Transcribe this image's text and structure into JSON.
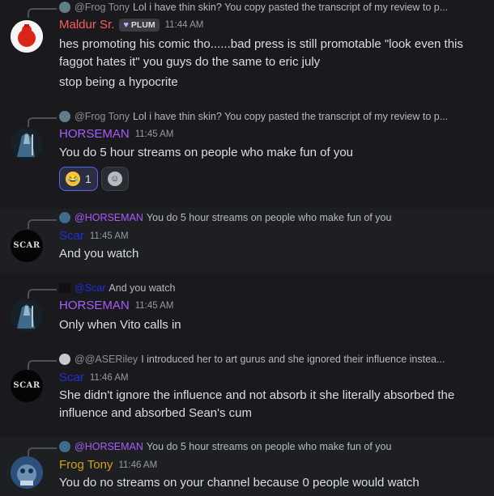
{
  "colors": {
    "maldur": "#ff5c5c",
    "horseman": "#a85cf9",
    "scar": "#1f2fd9",
    "frog": "#d4a017",
    "background": "#1a1a1e"
  },
  "messages": [
    {
      "reply": {
        "name": "@Frog Tony",
        "text": "Lol i have thin skin? You copy pasted the transcript of my review to p..."
      },
      "author": "Maldur Sr.",
      "badge": "PLUM",
      "time": "11:44 AM",
      "lines": [
        "hes promoting his comic tho......bad press is still promotable \"look even this faggot hates it\" you guys do the same to eric july",
        "stop being a hypocrite"
      ]
    },
    {
      "reply": {
        "name": "@Frog Tony",
        "text": "Lol i have thin skin? You copy pasted the transcript of my review to p..."
      },
      "author": "HORSEMAN",
      "time": "11:45 AM",
      "lines": [
        "You do 5 hour streams on people who make fun of you"
      ],
      "reactions": [
        {
          "emoji": "rofl-emoji",
          "count": "1"
        }
      ]
    },
    {
      "reply": {
        "name": "@HORSEMAN",
        "text": "You do 5 hour streams on people who make fun of you"
      },
      "author": "Scar",
      "time": "11:45 AM",
      "lines": [
        "And you watch"
      ]
    },
    {
      "reply": {
        "name": "@Scar",
        "text": "And you watch"
      },
      "author": "HORSEMAN",
      "time": "11:45 AM",
      "lines": [
        "Only when Vito calls in"
      ]
    },
    {
      "reply": {
        "name": "@@ASERiley",
        "text": "I introduced her to art gurus and she ignored their influence instea..."
      },
      "author": "Scar",
      "time": "11:46 AM",
      "lines": [
        "She didn't ignore the influence and not absorb it she literally absorbed the influence and absorbed Sean's cum"
      ]
    },
    {
      "reply": {
        "name": "@HORSEMAN",
        "text": "You do 5 hour streams on people who make fun of you"
      },
      "author": "Frog Tony",
      "time": "11:46 AM",
      "lines": [
        "You do no streams on your channel because 0 people would watch"
      ]
    }
  ],
  "avatar_text": {
    "scar": "SCAR"
  }
}
